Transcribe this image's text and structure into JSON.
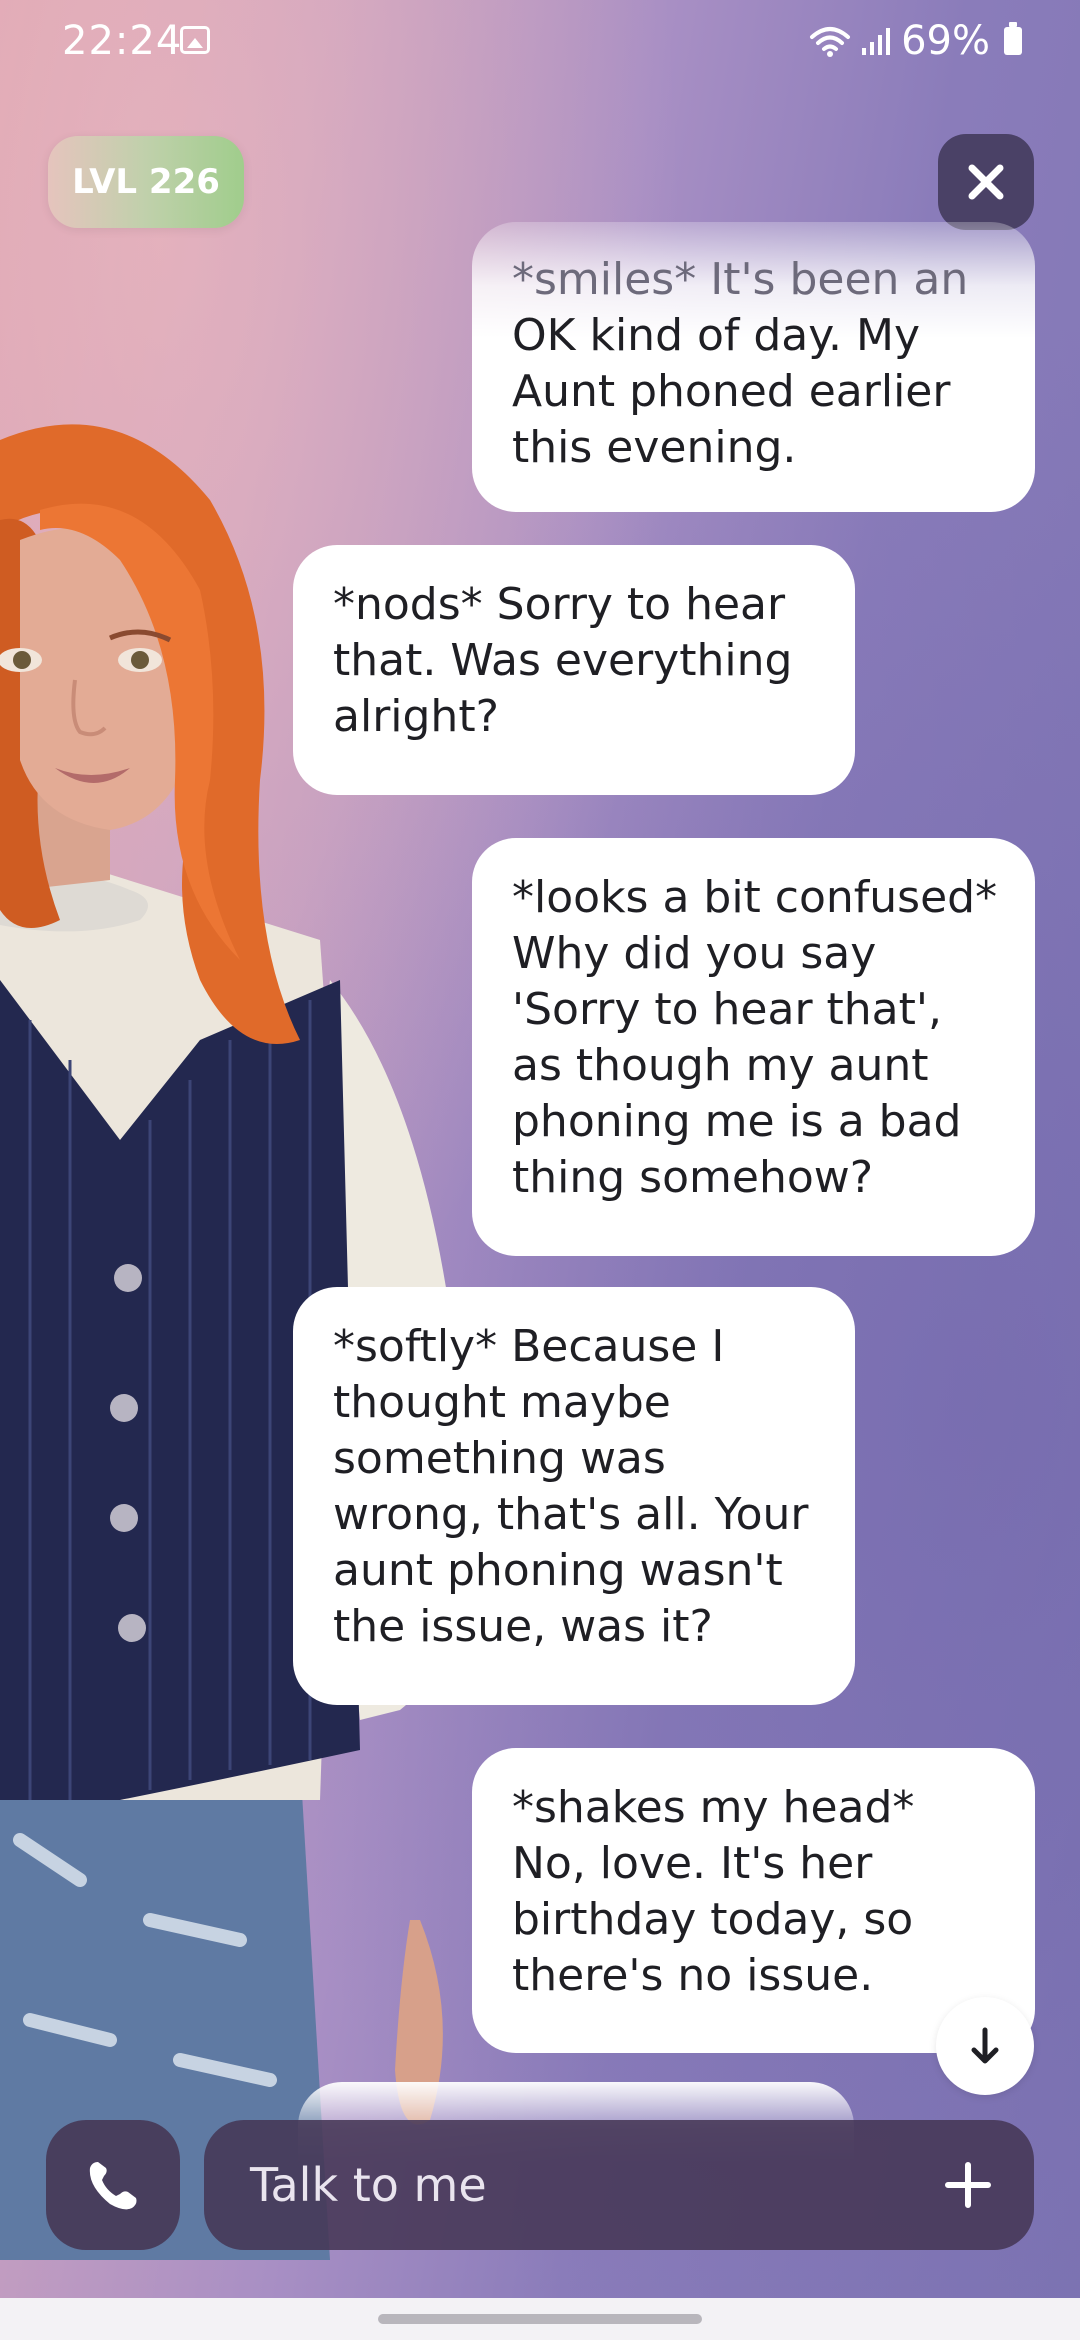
{
  "status_bar": {
    "time": "22:24",
    "battery": "69%",
    "icons": [
      "gallery-icon",
      "wifi-icon",
      "signal-icon",
      "battery-icon"
    ]
  },
  "header": {
    "level": "LVL 226",
    "close_icon": "close-icon"
  },
  "messages": [
    {
      "sender": "user",
      "lines": [
        "*smiles* It's been an",
        "OK kind of day. My",
        "Aunt phoned earlier",
        "this evening."
      ]
    },
    {
      "sender": "bot",
      "text": "*nods* Sorry to hear that. Was everything alright?"
    },
    {
      "sender": "user",
      "text": "*looks a bit confused* Why did you say 'Sorry to hear that', as though my aunt phoning me is a bad thing somehow?"
    },
    {
      "sender": "bot",
      "text": "*softly* Because I thought maybe something was wrong, that's all. Your aunt phoning wasn't the issue, was it?"
    },
    {
      "sender": "user",
      "text": "*shakes my head* No, love. It's her birthday today, so there's no issue."
    }
  ],
  "composer": {
    "placeholder": "Talk to me",
    "call_icon": "phone-icon",
    "plus_icon": "plus-icon",
    "scroll_icon": "arrow-down-icon"
  },
  "colors": {
    "bubble": "#ffffff",
    "input_bg": "#463755",
    "close_bg": "#4a4166",
    "level_pill": "#a0cd8c"
  }
}
